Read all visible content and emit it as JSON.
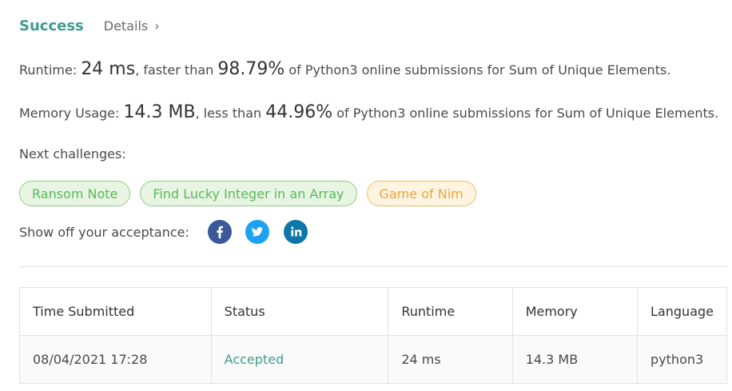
{
  "header": {
    "status": "Success",
    "details_label": "Details"
  },
  "runtime": {
    "label": "Runtime:",
    "value": "24 ms",
    "comparison": ", faster than",
    "percent": "98.79%",
    "suffix": "of Python3 online submissions for Sum of Unique Elements."
  },
  "memory": {
    "label": "Memory Usage:",
    "value": "14.3 MB",
    "comparison": ", less than",
    "percent": "44.96%",
    "suffix": "of Python3 online submissions for Sum of Unique Elements."
  },
  "next_challenges": {
    "label": "Next challenges:",
    "items": [
      {
        "label": "Ransom Note",
        "difficulty": "easy"
      },
      {
        "label": "Find Lucky Integer in an Array",
        "difficulty": "easy"
      },
      {
        "label": "Game of Nim",
        "difficulty": "medium"
      }
    ]
  },
  "share": {
    "label": "Show off your acceptance:",
    "icons": [
      "facebook-icon",
      "twitter-icon",
      "linkedin-icon"
    ]
  },
  "table": {
    "headers": [
      "Time Submitted",
      "Status",
      "Runtime",
      "Memory",
      "Language"
    ],
    "rows": [
      [
        "08/04/2021 17:28",
        "Accepted",
        "24 ms",
        "14.3 MB",
        "python3"
      ]
    ]
  },
  "colors": {
    "success": "#3f9c8f",
    "easy_text": "#5cb85c",
    "easy_bg": "#e8f5e3",
    "medium_text": "#e8a640",
    "medium_bg": "#fff4e0",
    "facebook": "#3b5998",
    "twitter": "#1da1f2",
    "linkedin": "#0e76a8"
  }
}
